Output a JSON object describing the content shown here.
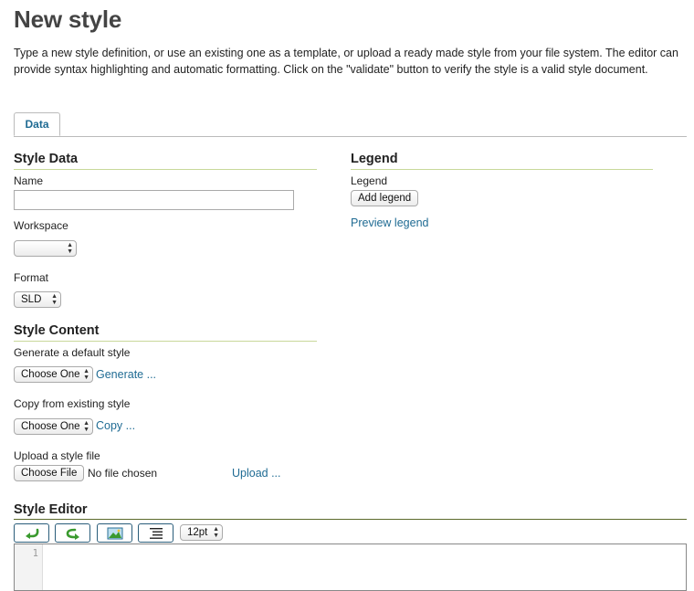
{
  "page": {
    "title": "New style",
    "intro": "Type a new style definition, or use an existing one as a template, or upload a ready made style from your file system. The editor can provide syntax highlighting and automatic formatting. Click on the \"validate\" button to verify the style is a valid style document."
  },
  "tabs": [
    {
      "label": "Data",
      "active": true
    }
  ],
  "style_data": {
    "heading": "Style Data",
    "name_label": "Name",
    "name_value": "",
    "workspace_label": "Workspace",
    "workspace_value": "",
    "format_label": "Format",
    "format_value": "SLD"
  },
  "legend": {
    "heading": "Legend",
    "label": "Legend",
    "add_button": "Add legend",
    "preview_link": "Preview legend"
  },
  "style_content": {
    "heading": "Style Content",
    "generate_label": "Generate a default style",
    "generate_select": "Choose One",
    "generate_link": "Generate ...",
    "copy_label": "Copy from existing style",
    "copy_select": "Choose One",
    "copy_link": "Copy ...",
    "upload_label": "Upload a style file",
    "choose_file_button": "Choose File",
    "no_file_text": "No file chosen",
    "upload_link": "Upload ..."
  },
  "editor": {
    "heading": "Style Editor",
    "toolbar": {
      "undo_icon": "undo-arrow-icon",
      "redo_icon": "redo-arrow-icon",
      "image_icon": "image-icon",
      "format_icon": "format-text-icon",
      "font_size": "12pt"
    },
    "line_numbers": [
      "1"
    ]
  },
  "colors": {
    "link": "#1f6b93",
    "section_rule": "#c8d89a",
    "toolbar_rule": "#5c6a2c",
    "icon_green": "#3a9a2e"
  }
}
